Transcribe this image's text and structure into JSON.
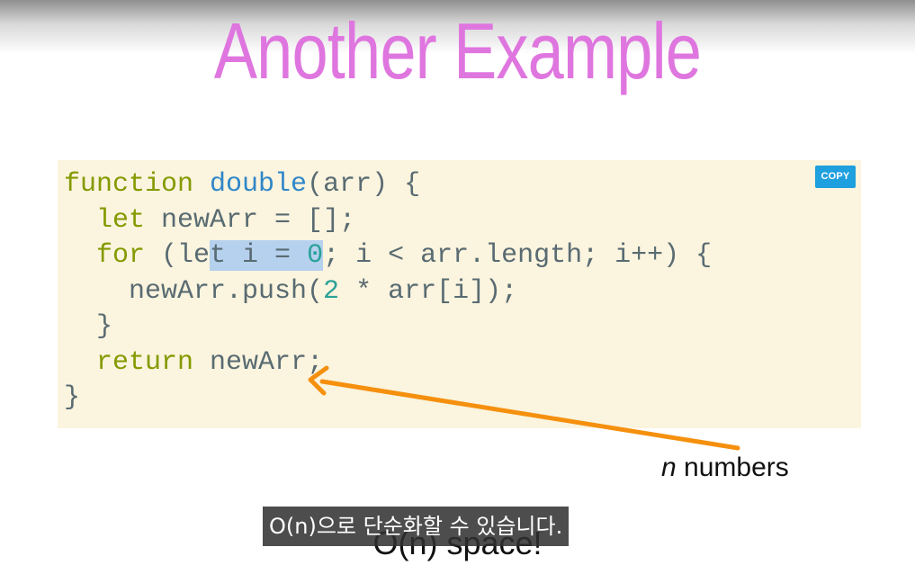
{
  "slide": {
    "title": "Another Example",
    "copy_label": "COPY",
    "annotation": {
      "italic": "n",
      "rest": " numbers"
    },
    "bottom_text": "O(n) space!",
    "code": {
      "l1_kw": "function",
      "l1_fn": "double",
      "l1_rest": "(arr) {",
      "l2_indent": "  ",
      "l2_kw": "let",
      "l2_rest": " newArr = [];",
      "l3_indent": "  ",
      "l3_kw": "for",
      "l3_a": " (le",
      "l3_b": "t i = ",
      "l3_num": "0",
      "l3_rest": "; i < arr.length; i++) {",
      "l4_a": "    newArr.push(",
      "l4_num": "2",
      "l4_rest": " * arr[i]);",
      "l5": "  }",
      "l6_indent": "  ",
      "l6_kw": "return",
      "l6_rest": " newArr;",
      "l7": "}"
    }
  },
  "video": {
    "subtitle": "O(n)으로 단순화할 수 있습니다."
  },
  "colors": {
    "title": "#df76df",
    "keyword": "#849a00",
    "function_name": "#2f86c8",
    "number": "#2aa198",
    "code_text": "#596b72",
    "code_background": "#fbf4de",
    "highlight": "#b5d1ee",
    "copy_button": "#1e9fde",
    "arrow": "#f5900e"
  }
}
